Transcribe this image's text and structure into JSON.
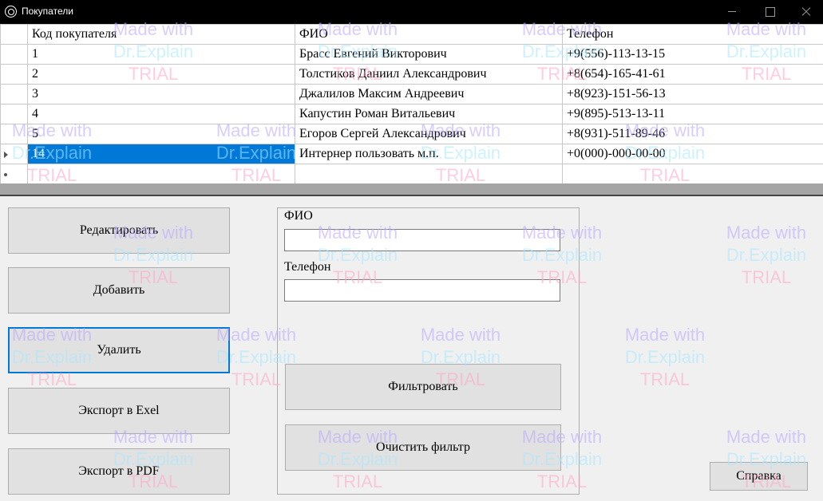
{
  "window": {
    "title": "Покупатели"
  },
  "grid": {
    "columns": [
      "Код покупателя",
      "ФИО",
      "Телефон"
    ],
    "rows": [
      [
        "1",
        "Брасс Евгений Викторович",
        "+9(556)-113-13-15"
      ],
      [
        "2",
        "Толстиков Даниил Александрович",
        "+8(654)-165-41-61"
      ],
      [
        "3",
        "Джалилов Максим Андреевич",
        "+8(923)-151-56-13"
      ],
      [
        "4",
        "Капустин Роман Витальевич",
        "+9(895)-513-13-11"
      ],
      [
        "5",
        "Егоров Сергей Александрович",
        "+8(931)-511-89-46"
      ],
      [
        "14",
        "Интернер пользовать м.п.",
        "+0(000)-000-00-00"
      ]
    ],
    "selected_row": "14"
  },
  "buttons": {
    "edit": "Редактировать",
    "add": "Добавить",
    "delete": "Удалить",
    "export_excel": "Экспорт в Exel",
    "export_pdf": "Экспорт в PDF",
    "filter": "Фильтровать",
    "clear_filter": "Очистить фильтр",
    "help": "Справка"
  },
  "filter": {
    "name_label": "ФИО",
    "name_value": "",
    "phone_label": "Телефон",
    "phone_value": ""
  },
  "watermark": {
    "line1": "Made with",
    "line2": "Dr.Explain",
    "line3": "TRIAL"
  },
  "colors": {
    "selection": "#0078d7",
    "titlebar": "#000000",
    "focus_border": "#0078d7"
  }
}
